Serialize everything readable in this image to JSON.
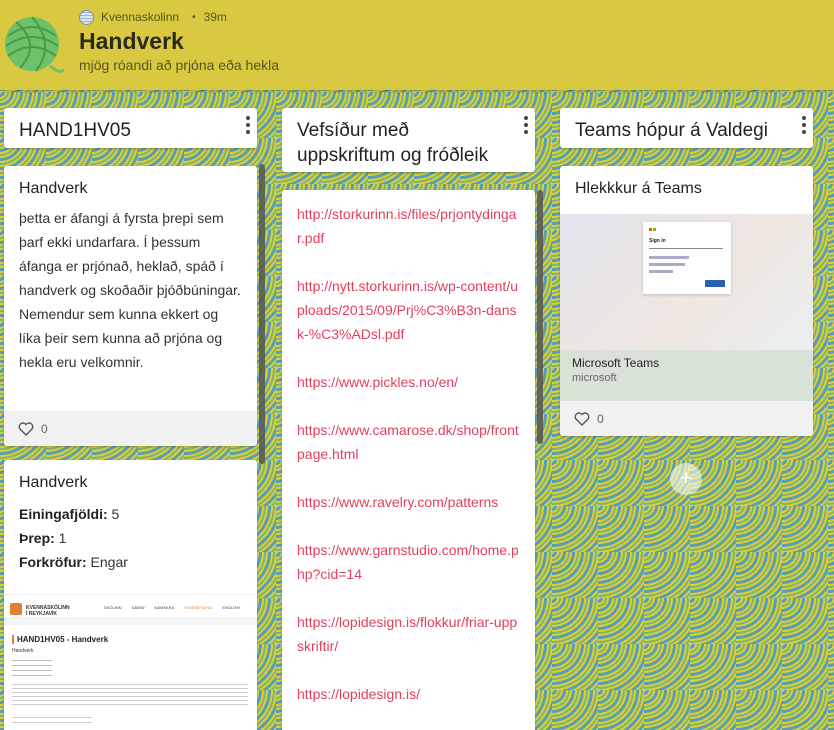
{
  "header": {
    "author": "Kvennaskolinn",
    "time": "39m",
    "title": "Handverk",
    "subtitle": "mjög róandi að prjóna eða hekla"
  },
  "columns": [
    {
      "title": "HAND1HV05",
      "cards": [
        {
          "title": "Handverk",
          "text": "þetta er áfangi á fyrsta þrepi sem þarf ekki undarfara.  Í þessum áfanga er prjónað, heklað, spáð í handverk og skoðaðir þjóðbúningar.  Nemendur sem kunna ekkert og líka þeir sem kunna að prjóna og hekla eru velkomnir.",
          "likes": "0"
        },
        {
          "title": "Handverk",
          "fields": [
            {
              "label": "Einingafjöldi:",
              "value": " 5"
            },
            {
              "label": "Þrep:",
              "value": " 1"
            },
            {
              "label": "Forkröfur:",
              "value": " Engar"
            }
          ],
          "preview": {
            "school": "KVENNASKÓLINN Í REYKJAVÍK",
            "nav": [
              "SKÓLINN",
              "NÁMIÐ",
              "NÁMSKRÁ",
              "STAÐSETNING",
              "ENGLISH"
            ],
            "page_title": "HAND1HV05 - Handverk",
            "subtitle": "Handverk"
          }
        }
      ]
    },
    {
      "title": "Vefsíður með uppskriftum og fróðleik",
      "links": [
        "http://storkurinn.is/files/prjontydingar.pdf",
        "http://nytt.storkurinn.is/wp-content/uploads/2015/09/Prj%C3%B3n-dansk-%C3%ADsl.pdf",
        "https://www.pickles.no/en/",
        "https://www.camarose.dk/shop/frontpage.html",
        "https://www.ravelry.com/patterns",
        "https://www.garnstudio.com/home.php?cid=14",
        "https://lopidesign.is/flokkur/friar-uppskriftir/",
        "https://lopidesign.is/"
      ]
    },
    {
      "title": "Teams hópur á Valdegi",
      "cards": [
        {
          "title": "Hlekkkur á Teams",
          "link_name": "Microsoft Teams",
          "link_domain": "microsoft",
          "likes": "0",
          "preview_heading": "Sign in"
        }
      ]
    }
  ],
  "add_label": "+",
  "colors": {
    "header_bg": "#d8c940",
    "link": "#e0405e"
  }
}
